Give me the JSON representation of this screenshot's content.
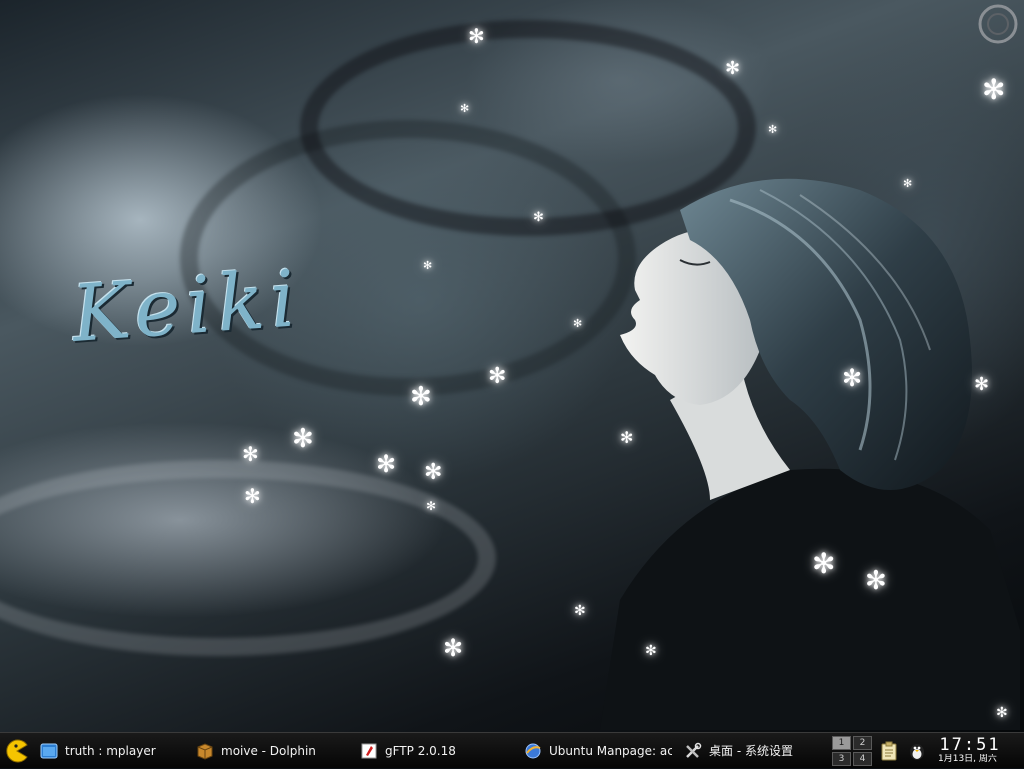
{
  "wallpaper": {
    "signature_text": "Keiki",
    "snowflake_glyph": "✻"
  },
  "taskbar": {
    "kmenu_icon": "kmenu-pacman-icon",
    "tasks": [
      {
        "label": "truth : mplayer",
        "icon": "window-icon"
      },
      {
        "label": "moive - Dolphin",
        "icon": "folder-box-icon"
      },
      {
        "label": "gFTP 2.0.18",
        "icon": "gftp-icon"
      },
      {
        "label": "Ubuntu Manpage: accept",
        "icon": "browser-icon"
      },
      {
        "label": "桌面 - 系统设置",
        "icon": "tools-icon"
      }
    ],
    "pager": [
      "1",
      "2",
      "3",
      "4"
    ],
    "active_desktop": "1",
    "tray": [
      "clipboard-icon",
      "tux-icon"
    ],
    "clock": {
      "time": "17:51",
      "date": "1月13日, 周六"
    }
  }
}
